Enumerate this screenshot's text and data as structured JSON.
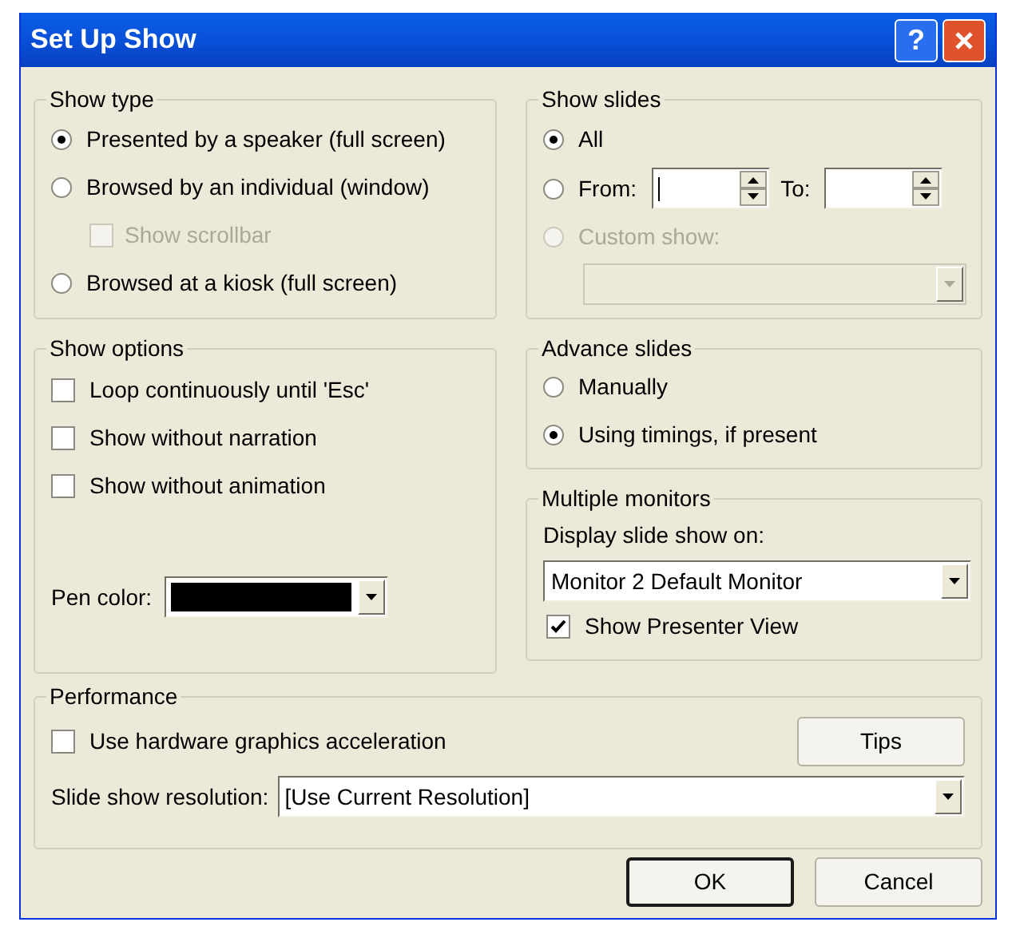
{
  "window": {
    "title": "Set Up Show"
  },
  "title_buttons": [
    {
      "kind": "help",
      "label": "?"
    },
    {
      "kind": "close"
    }
  ],
  "show_type": {
    "title": "Show type",
    "options": [
      {
        "label": "Presented by a speaker (full screen)",
        "selected": true
      },
      {
        "label": "Browsed by an individual (window)",
        "selected": false,
        "children": [
          {
            "label": "Show scrollbar",
            "checked": false,
            "disabled": true
          }
        ]
      },
      {
        "label": "Browsed at a kiosk (full screen)",
        "selected": false
      }
    ]
  },
  "show_options": {
    "title": "Show options",
    "checkboxes": [
      {
        "label": "Loop continuously until 'Esc'",
        "checked": false
      },
      {
        "label": "Show without narration",
        "checked": false
      },
      {
        "label": "Show without animation",
        "checked": false
      }
    ],
    "pen_color": {
      "label": "Pen color:",
      "color": "#000000"
    }
  },
  "show_slides": {
    "title": "Show slides",
    "options": [
      {
        "kind": "plain",
        "label": "All",
        "selected": true,
        "disabled": false
      },
      {
        "kind": "range",
        "label": "From:",
        "selected": false,
        "disabled": false,
        "from_focused": true,
        "to_label": "To:"
      },
      {
        "kind": "custom",
        "label": "Custom show:",
        "selected": false,
        "disabled": true
      }
    ]
  },
  "advance_slides": {
    "title": "Advance slides",
    "options": [
      {
        "label": "Manually",
        "selected": false
      },
      {
        "label": "Using timings, if present",
        "selected": true
      }
    ]
  },
  "multiple_monitors": {
    "title": "Multiple monitors",
    "display_label": "Display slide show on:",
    "display_value": "Monitor 2 Default Monitor",
    "presenter_view": {
      "label": "Show Presenter View",
      "checked": true
    }
  },
  "performance": {
    "title": "Performance",
    "hardware": {
      "label": "Use hardware graphics acceleration",
      "checked": false
    },
    "tips_button": "Tips",
    "resolution_label": "Slide show resolution:",
    "resolution_value": "[Use Current Resolution]"
  },
  "buttons": [
    {
      "label": "OK",
      "default": true
    },
    {
      "label": "Cancel",
      "default": false
    }
  ]
}
